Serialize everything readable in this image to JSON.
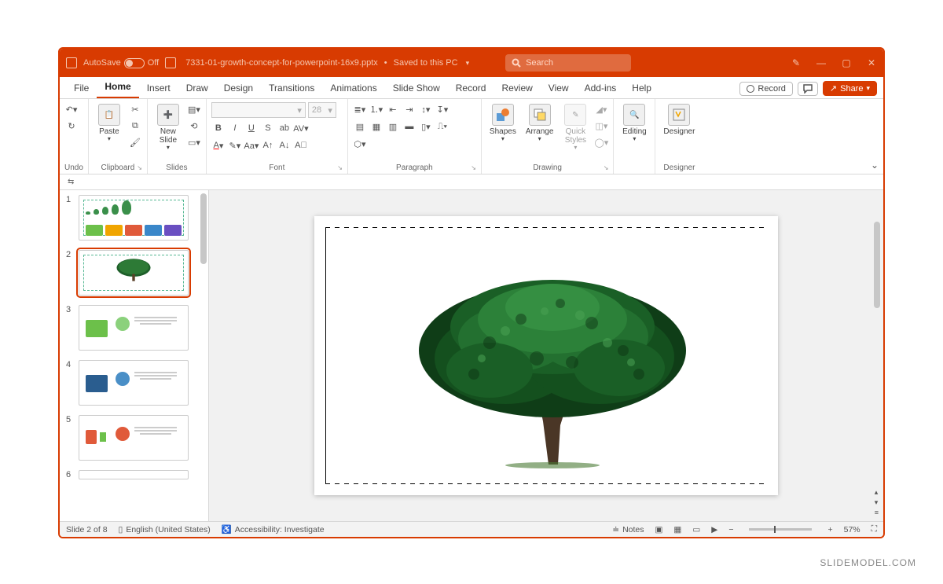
{
  "titlebar": {
    "autosave_label": "AutoSave",
    "autosave_state": "Off",
    "filename": "7331-01-growth-concept-for-powerpoint-16x9.pptx",
    "save_status": "Saved to this PC",
    "search_placeholder": "Search"
  },
  "tabs": [
    "File",
    "Home",
    "Insert",
    "Draw",
    "Design",
    "Transitions",
    "Animations",
    "Slide Show",
    "Record",
    "Review",
    "View",
    "Add-ins",
    "Help"
  ],
  "active_tab": "Home",
  "tabs_right": {
    "record": "Record",
    "share": "Share"
  },
  "ribbon": {
    "undo_group": "Undo",
    "clipboard_group": "Clipboard",
    "paste": "Paste",
    "slides_group": "Slides",
    "new_slide": "New\nSlide",
    "font_group": "Font",
    "font_size": "28",
    "paragraph_group": "Paragraph",
    "drawing_group": "Drawing",
    "shapes": "Shapes",
    "arrange": "Arrange",
    "quick_styles": "Quick\nStyles",
    "editing": "Editing",
    "designer_group": "Designer",
    "designer": "Designer"
  },
  "thumbnails": [
    1,
    2,
    3,
    4,
    5,
    6
  ],
  "selected_thumb": 2,
  "status": {
    "slide": "Slide 2 of 8",
    "language": "English (United States)",
    "accessibility": "Accessibility: Investigate",
    "notes": "Notes",
    "zoom": "57%"
  },
  "watermark": "SLIDEMODEL.COM"
}
